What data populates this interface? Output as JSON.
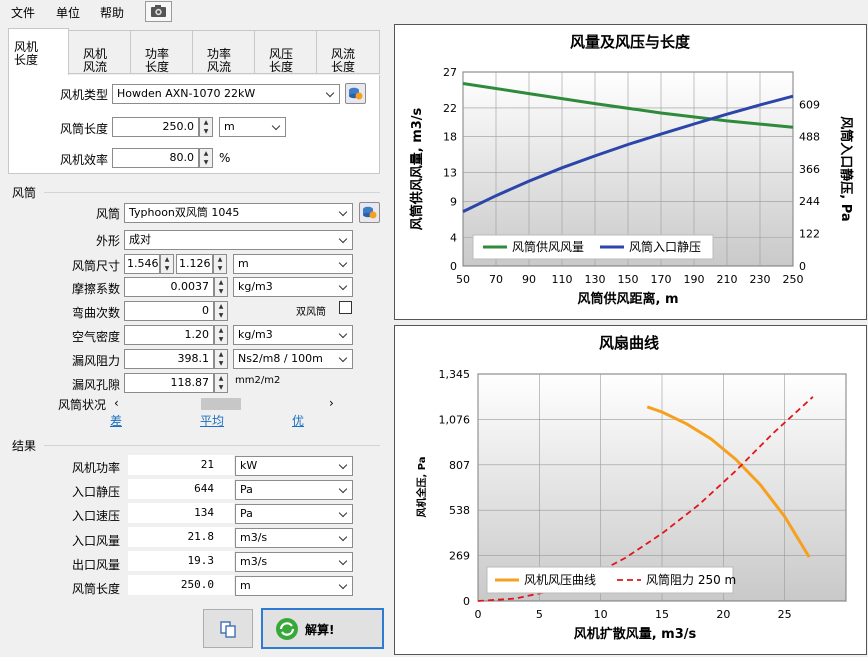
{
  "menu": {
    "file": "文件",
    "unit": "单位",
    "help": "帮助",
    "camera_icon": "camera-icon"
  },
  "tabs": [
    {
      "line1": "风机",
      "line2": "长度"
    },
    {
      "line1": "风机",
      "line2": "风流"
    },
    {
      "line1": "功率",
      "line2": "长度"
    },
    {
      "line1": "功率",
      "line2": "风流"
    },
    {
      "line1": "风压",
      "line2": "长度"
    },
    {
      "line1": "风流",
      "line2": "长度"
    }
  ],
  "fan": {
    "type_label": "风机类型",
    "type_value": "Howden AXN-1070 22kW",
    "length_label": "风筒长度",
    "length_value": "250.0",
    "length_unit": "m",
    "eff_label": "风机效率",
    "eff_value": "80.0",
    "eff_unit": "%"
  },
  "duct": {
    "group": "风筒",
    "duct_label": "风筒",
    "duct_value": "Typhoon双风筒 1045",
    "shape_label": "外形",
    "shape_value": "成对",
    "size_label": "风筒尺寸",
    "size_a": "1.546",
    "size_b": "1.126",
    "size_unit": "m",
    "friction_label": "摩擦系数",
    "friction_value": "0.0037",
    "friction_unit": "kg/m3",
    "bends_label": "弯曲次数",
    "bends_value": "0",
    "double_label": "双风筒",
    "density_label": "空气密度",
    "density_value": "1.20",
    "density_unit": "kg/m3",
    "leak_res_label": "漏风阻力",
    "leak_res_value": "398.1",
    "leak_res_unit": "Ns2/m8 / 100m",
    "leak_hole_label": "漏风孔隙",
    "leak_hole_value": "118.87",
    "leak_hole_unit": "mm2/m2",
    "cond_label": "风筒状况",
    "cond_bad": "差",
    "cond_avg": "平均",
    "cond_good": "优"
  },
  "results": {
    "group": "结果",
    "rows": [
      {
        "label": "风机功率",
        "value": "21",
        "unit": "kW"
      },
      {
        "label": "入口静压",
        "value": "644",
        "unit": "Pa"
      },
      {
        "label": "入口速压",
        "value": "134",
        "unit": "Pa"
      },
      {
        "label": "入口风量",
        "value": "21.8",
        "unit": "m3/s"
      },
      {
        "label": "出口风量",
        "value": "19.3",
        "unit": "m3/s"
      },
      {
        "label": "风筒长度",
        "value": "250.0",
        "unit": "m"
      }
    ]
  },
  "buttons": {
    "copy_icon": "copy-icon",
    "solve": "解算!"
  },
  "colors": {
    "green": "#2e8b3a",
    "blue": "#2b46a8",
    "orange": "#f5a01f",
    "red": "#e0161b",
    "link": "#1a6fc0"
  },
  "chart_data": [
    {
      "type": "line",
      "title": "风量及风压与长度",
      "xlabel": "风筒供风距离, m",
      "ylabel": "风筒供风风量, m3/s",
      "y2label": "风筒入口静压, Pa",
      "xlim": [
        50,
        250
      ],
      "ylim": [
        0,
        27
      ],
      "y2lim": [
        0,
        731
      ],
      "x_ticks": [
        50,
        70,
        90,
        110,
        130,
        150,
        170,
        190,
        210,
        230,
        250
      ],
      "y_ticks": [
        0,
        4,
        9,
        13,
        18,
        22,
        27
      ],
      "y2_ticks": [
        0,
        122,
        244,
        366,
        488,
        609
      ],
      "legend_position": "bottom-left",
      "series": [
        {
          "name": "风筒供风风量",
          "axis": "left",
          "color": "#2e8b3a",
          "x": [
            50,
            90,
            130,
            170,
            210,
            250
          ],
          "y": [
            25.4,
            24.0,
            22.6,
            21.3,
            20.2,
            19.3
          ]
        },
        {
          "name": "风筒入口静压",
          "axis": "right",
          "color": "#2b46a8",
          "x": [
            50,
            70,
            90,
            110,
            130,
            150,
            170,
            190,
            210,
            230,
            250
          ],
          "y": [
            205,
            265,
            320,
            370,
            415,
            458,
            497,
            535,
            572,
            607,
            640
          ]
        }
      ]
    },
    {
      "type": "line",
      "title": "风扇曲线",
      "xlabel": "风机扩散风量, m3/s",
      "ylabel": "风机全压, Pa",
      "xlim": [
        0,
        30
      ],
      "ylim": [
        0,
        1345
      ],
      "x_ticks": [
        0,
        5,
        10,
        15,
        20,
        25
      ],
      "y_ticks": [
        0,
        269,
        538,
        807,
        1076,
        1345
      ],
      "y_tick_labels": [
        "0",
        "269",
        "538",
        "807",
        "1,076",
        "1,345"
      ],
      "legend_position": "bottom-left",
      "series": [
        {
          "name": "风机风压曲线",
          "color": "#f5a01f",
          "dash": false,
          "x": [
            13.8,
            15,
            17,
            19,
            21,
            23,
            25,
            27
          ],
          "y": [
            1150,
            1120,
            1050,
            960,
            840,
            690,
            500,
            260
          ]
        },
        {
          "name": "风筒阻力 250 m",
          "color": "#e0161b",
          "dash": true,
          "x": [
            0,
            3,
            6,
            9,
            12,
            15,
            18,
            21,
            24,
            27.3
          ],
          "y": [
            0,
            14,
            60,
            140,
            255,
            400,
            570,
            770,
            990,
            1210
          ]
        }
      ]
    }
  ]
}
